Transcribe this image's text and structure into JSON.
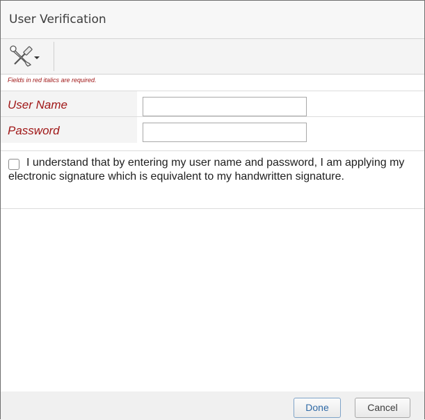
{
  "dialog": {
    "title": "User Verification"
  },
  "toolbar": {
    "tools_icon": "tools-wrench-screwdriver-icon",
    "dropdown_icon": "caret-down-icon"
  },
  "form": {
    "required_note": "Fields in red italics are required.",
    "user_name_label": "User Name",
    "user_name_value": "",
    "password_label": "Password",
    "password_value": ""
  },
  "signature": {
    "checked": false,
    "text": "I understand that by entering my user name and password, I am applying my electronic signature which is equivalent to my handwritten signature."
  },
  "buttons": {
    "done_label": "Done",
    "cancel_label": "Cancel"
  },
  "colors": {
    "required_label": "#a01818",
    "done_text": "#2f6aa6"
  }
}
